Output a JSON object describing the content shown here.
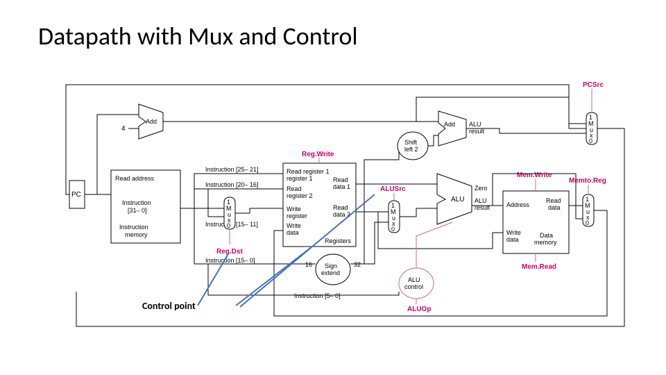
{
  "title": "Datapath with Mux and Control",
  "annotation": "Control point",
  "signals": {
    "pcsrc": "PCSrc",
    "regwrite": "Reg.Write",
    "regdst": "Reg.Dst",
    "aluop": "ALUOp",
    "alusrc": "ALUSrc",
    "memwrite": "Mem.Write",
    "memread": "Mem.Read",
    "memtoreg": "Memto.Reg"
  },
  "blocks": {
    "pc": "PC",
    "imem_addr": "Read address",
    "imem_instr": "Instruction [31– 0]",
    "imem_name": "Instruction memory",
    "add1": "Add",
    "four": "4",
    "add2": "Add",
    "alu_result2": "ALU result",
    "shiftleft": "Shift left 2",
    "regfile": "Registers",
    "rr1": "Read register 1",
    "rr2": "Read register 2",
    "wr": "Write register",
    "wd": "Write data",
    "rd1": "Read data 1",
    "rd2": "Read data 2",
    "signext": "Sign extend",
    "sixteen": "16",
    "thirtytwo": "32",
    "alu": "ALU",
    "zero": "Zero",
    "alu_result": "ALU result",
    "alucontrol": "ALU control",
    "dmem_addr": "Address",
    "dmem_rd": "Read data",
    "dmem_wd": "Write data",
    "dmem_name": "Data memory",
    "instr25_21": "Instruction [25– 21]",
    "instr20_16": "Instruction [20– 16]",
    "instr15_11": "Instruction [15– 11]",
    "instr15_0": "Instruction [15– 0]",
    "instr5_0": "Instruction [5– 0]",
    "mux": {
      "one": "1",
      "m": "M",
      "u": "u",
      "x": "x",
      "zero": "0"
    }
  }
}
